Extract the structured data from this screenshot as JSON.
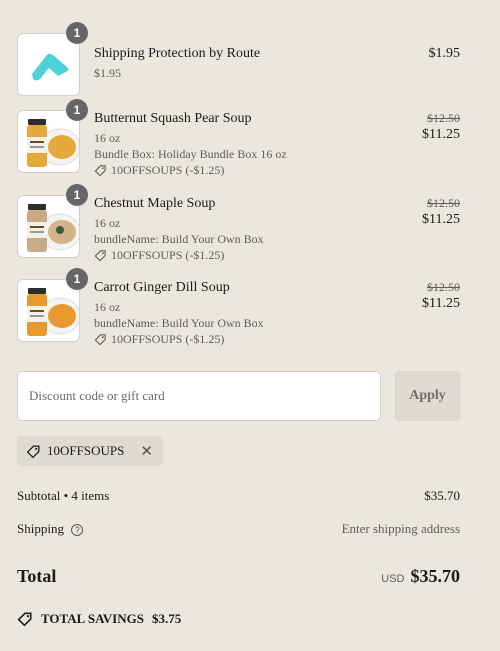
{
  "items": [
    {
      "quantity": "1",
      "name": "Shipping Protection by Route",
      "details": [
        "$1.95"
      ],
      "discount": "",
      "original_price": "",
      "price": "$1.95",
      "thumb_icon": "route-logo-icon"
    },
    {
      "quantity": "1",
      "name": "Butternut Squash Pear Soup",
      "details": [
        "16 oz",
        "Bundle Box: Holiday Bundle Box 16 oz"
      ],
      "discount": "10OFFSOUPS (-$1.25)",
      "original_price": "$12.50",
      "price": "$11.25",
      "thumb_icon": "soup-jar-icon",
      "soup_color": "#e5a83a"
    },
    {
      "quantity": "1",
      "name": "Chestnut Maple Soup",
      "details": [
        "16 oz",
        "bundleName: Build Your Own Box"
      ],
      "discount": "10OFFSOUPS (-$1.25)",
      "original_price": "$12.50",
      "price": "$11.25",
      "thumb_icon": "soup-jar-icon",
      "soup_color": "#d2b48a"
    },
    {
      "quantity": "1",
      "name": "Carrot Ginger Dill Soup",
      "details": [
        "16 oz",
        "bundleName: Build Your Own Box"
      ],
      "discount": "10OFFSOUPS (-$1.25)",
      "original_price": "$12.50",
      "price": "$11.25",
      "thumb_icon": "soup-jar-icon",
      "soup_color": "#e89a2e"
    }
  ],
  "discount": {
    "placeholder": "Discount code or gift card",
    "apply_label": "Apply",
    "applied_code": "10OFFSOUPS"
  },
  "summary": {
    "subtotal_label": "Subtotal • 4 items",
    "subtotal_value": "$35.70",
    "shipping_label": "Shipping",
    "shipping_value": "Enter shipping address",
    "total_label": "Total",
    "currency": "USD",
    "total_value": "$35.70",
    "savings_label": "TOTAL SAVINGS",
    "savings_value": "$3.75"
  },
  "colors": {
    "background": "#ebe7df",
    "badge": "#666666",
    "route_accent": "#4fd1d9"
  }
}
